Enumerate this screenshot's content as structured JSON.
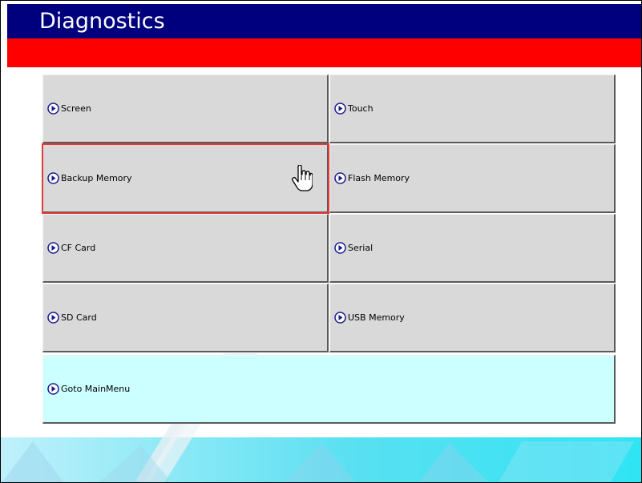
{
  "header": {
    "title": "Diagnostics"
  },
  "menu": {
    "screen": "Screen",
    "touch": "Touch",
    "backup_memory": "Backup Memory",
    "flash_memory": "Flash Memory",
    "cf_card": "CF Card",
    "serial": "Serial",
    "sd_card": "SD Card",
    "usb_memory": "USB Memory",
    "goto_main_menu": "Goto MainMenu"
  },
  "state": {
    "selected_item": "Backup Memory"
  },
  "colors": {
    "title_bar": "#00007f",
    "accent_bar": "#ff0000",
    "button_face": "#d9d9d9",
    "main_menu_button": "#ccffff",
    "selection": "#e23a3a"
  },
  "icons": {
    "menu_arrow": "circle-arrow-right-icon",
    "pointer": "hand-cursor-icon"
  }
}
